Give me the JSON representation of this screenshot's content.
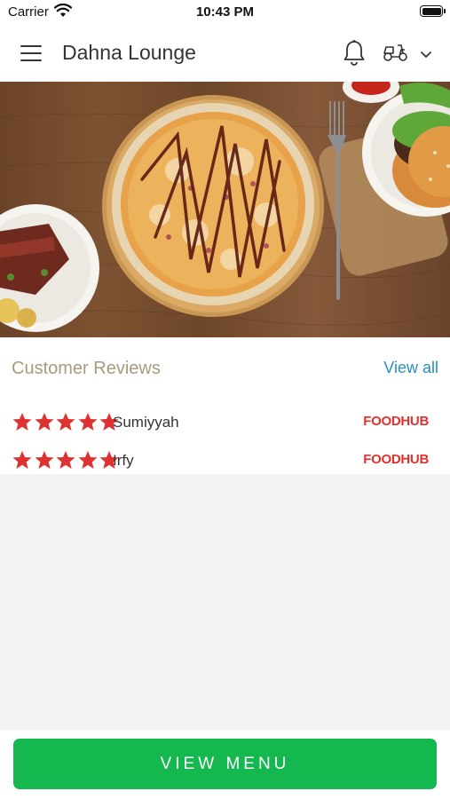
{
  "status_bar": {
    "carrier": "Carrier",
    "time": "10:43 PM"
  },
  "header": {
    "restaurant_name": "Dahna Lounge",
    "icons": [
      "menu-icon",
      "bell-icon",
      "delivery-scooter-icon",
      "chevron-down-icon"
    ]
  },
  "hero": {
    "image": "pizza-and-food-spread-photo"
  },
  "reviews": {
    "title": "Customer Reviews",
    "view_all_label": "View all",
    "items": [
      {
        "rating": 5,
        "name": "Sumiyyah",
        "source": "FOODHUB"
      },
      {
        "rating": 5,
        "name": "Irfy",
        "source": "FOODHUB"
      }
    ]
  },
  "bottom": {
    "view_menu_label": "VIEW MENU"
  },
  "colors": {
    "accent_green": "#14b84e",
    "link_blue": "#2a8ec4",
    "star_red": "#e03131",
    "section_title": "#a89a7a"
  }
}
